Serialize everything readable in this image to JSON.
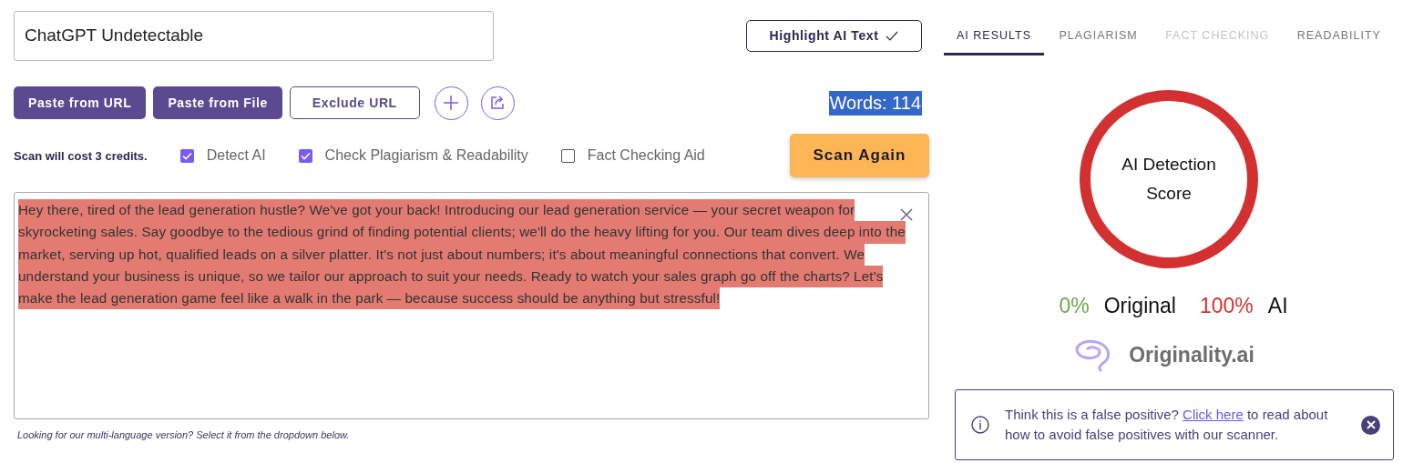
{
  "title_field": {
    "value": "ChatGPT Undetectable"
  },
  "highlight_button": {
    "label": "Highlight AI Text",
    "checked": true
  },
  "source_buttons": [
    {
      "kind": "primary",
      "label": "Paste from URL"
    },
    {
      "kind": "primary",
      "label": "Paste from File"
    },
    {
      "kind": "outline",
      "label": "Exclude URL"
    },
    {
      "kind": "add"
    },
    {
      "kind": "share"
    }
  ],
  "word_count": {
    "label": "Words: 114",
    "selected": true
  },
  "cost_note": "Scan will cost 3 credits.",
  "options": [
    {
      "label": "Detect AI",
      "checked": true
    },
    {
      "label": "Check Plagiarism & Readability",
      "checked": true
    },
    {
      "label": "Fact Checking Aid",
      "checked": false
    }
  ],
  "scan_button": "Scan Again",
  "editor": {
    "highlighted": true,
    "lines": [
      "Hey there, tired of the lead generation hustle? We've got your back! Introducing our lead generation service — your secret weapon for",
      "skyrocketing sales. Say goodbye to the tedious grind of finding potential clients; we'll do the heavy lifting for you. Our team dives deep into the",
      "market, serving up hot, qualified leads on a silver platter. It's not just about numbers; it's about meaningful connections that convert. We",
      "understand your business is unique, so we tailor our approach to suit your needs. Ready to watch your sales graph go off the charts? Let's",
      "make the lead generation game feel like a walk in the park — because success should be anything but stressful!"
    ]
  },
  "hint": "Looking for our multi-language version? Select it from the dropdown below.",
  "tabs": [
    {
      "label": "AI RESULTS",
      "selected": true,
      "disabled": false
    },
    {
      "label": "PLAGIARISM",
      "selected": false,
      "disabled": false
    },
    {
      "label": "FACT CHECKING",
      "selected": false,
      "disabled": true
    },
    {
      "label": "READABILITY",
      "selected": false,
      "disabled": false
    }
  ],
  "score": {
    "label": "AI Detection Score"
  },
  "results": {
    "original_percent": "0%",
    "original_label": "Original",
    "ai_percent": "100%",
    "ai_label": "AI"
  },
  "logo": "Originality.ai",
  "notice": {
    "before": "Think this is a false positive? ",
    "link": "Click here",
    "after": " to read about how to avoid false positives with our scanner."
  }
}
